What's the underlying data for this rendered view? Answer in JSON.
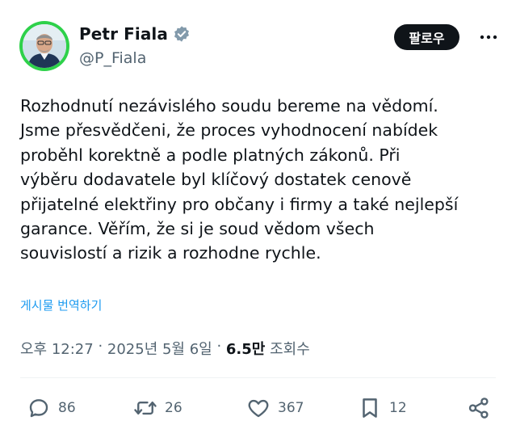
{
  "author": {
    "display_name": "Petr Fiala",
    "handle": "@P_Fiala",
    "verified_icon": "verified-badge-icon"
  },
  "follow_label": "팔로우",
  "tweet_text": "Rozhodnutí nezávislého soudu bereme na vědomí.\nJsme přesvědčeni, že proces vyhodnocení nabídek\nproběhl korektně a podle platných zákonů. Při\nvýběru dodavatele byl klíčový dostatek cenově\npřijatelné elektřiny pro občany i firmy a také nejlepší\ngarance. Věřím, že si je soud vědom všech\nsouvislostí a rizik a rozhodne rychle.",
  "translate_label": "게시물 번역하기",
  "meta": {
    "time": "오후 12:27",
    "sep1": " · ",
    "date": "2025년 5월 6일",
    "sep2": " · ",
    "views_count": "6.5만",
    "views_label": " 조회수"
  },
  "actions": {
    "replies": "86",
    "reposts": "26",
    "likes": "367",
    "bookmarks": "12"
  },
  "colors": {
    "avatar_ring": "#2ed14a",
    "link_blue": "#1d9bf0",
    "muted": "#536471"
  }
}
